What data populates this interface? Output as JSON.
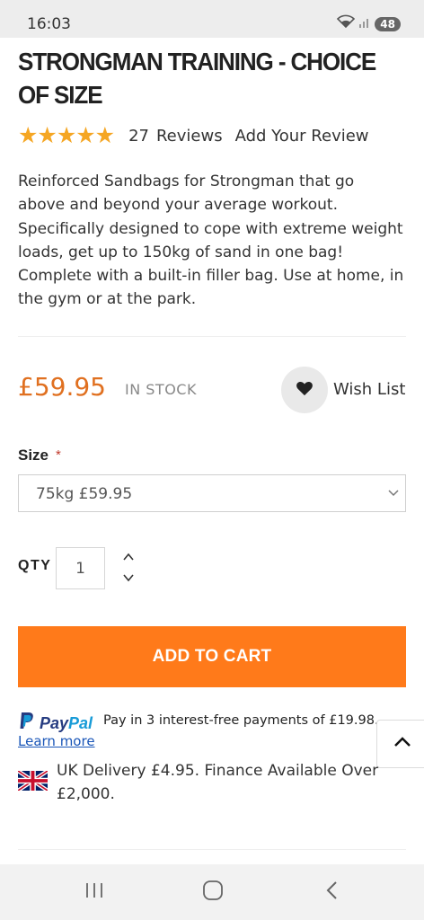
{
  "status_bar": {
    "time": "16:03",
    "battery": "48",
    "icons": [
      "wifi-icon",
      "signal-icon",
      "battery-icon"
    ]
  },
  "product": {
    "title": "STRONGMAN TRAINING - CHOICE OF SIZE",
    "rating": {
      "stars": 5,
      "review_count": "27",
      "reviews_label": "Reviews",
      "add_review_label": "Add Your Review"
    },
    "description": "Reinforced Sandbags for Strongman that go above and beyond your average workout. Specifically designed to cope with extreme weight loads, get up to 150kg of sand in one bag! Complete with a built-in filler bag. Use at home, in the gym or at the park.",
    "price": "£59.95",
    "stock_status": "IN STOCK",
    "wish_list_label": "Wish List"
  },
  "options": {
    "size_label": "Size",
    "required_marker": "*",
    "size_selected": "75kg £59.95",
    "qty_label": "QTY",
    "qty_value": "1"
  },
  "actions": {
    "add_to_cart": "ADD TO CART"
  },
  "paypal": {
    "brand_pay": "Pay",
    "brand_pal": "Pal",
    "message": "Pay in 3 interest-free payments of £19.98.",
    "learn_more": "Learn more"
  },
  "delivery": {
    "text": "UK Delivery £4.95. Finance Available Over £2,000."
  },
  "colors": {
    "accent": "#ff7a1a",
    "price": "#e07020",
    "stars": "#f5a623",
    "paypal_dark": "#253b80",
    "paypal_light": "#179bd7",
    "link": "#1a56b8"
  },
  "nav_bar": {
    "icons": [
      "recent-apps-icon",
      "home-icon",
      "back-icon"
    ]
  }
}
